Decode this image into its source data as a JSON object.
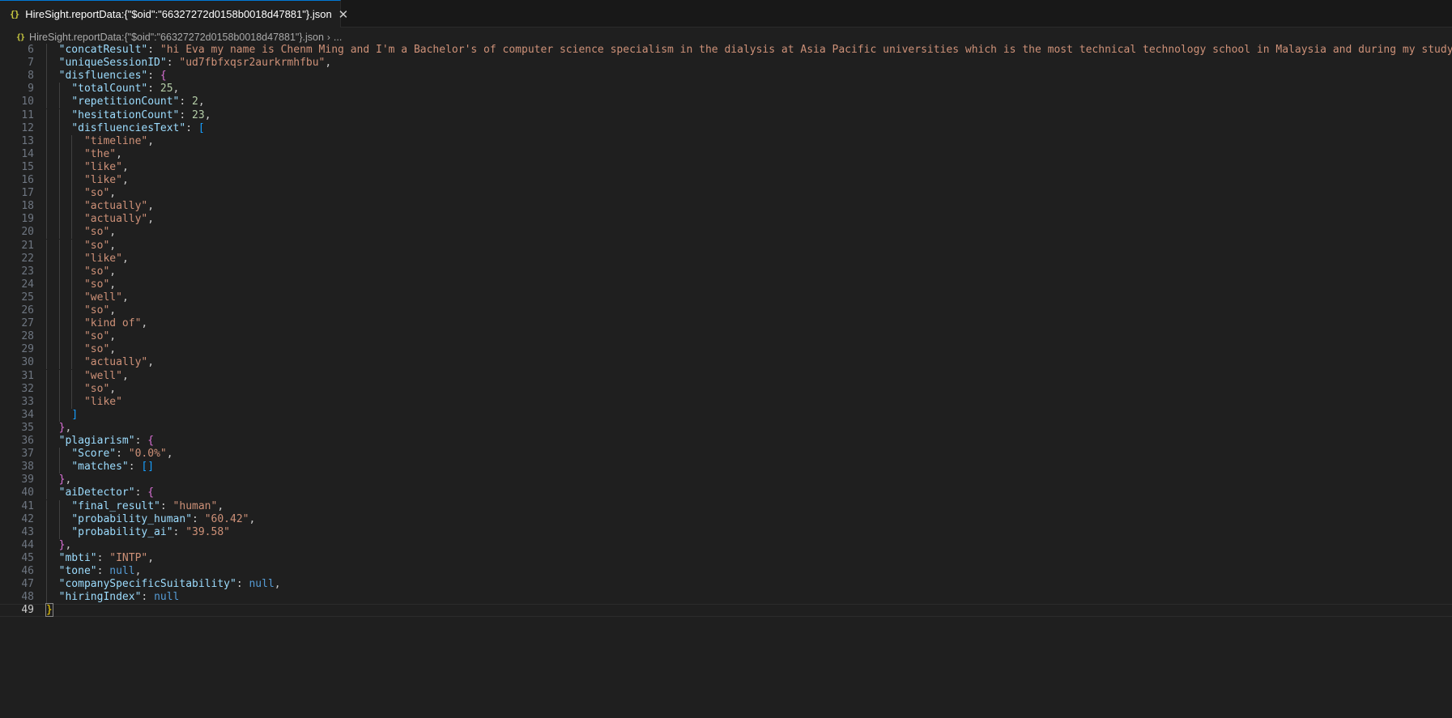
{
  "tab": {
    "title": "HireSight.reportData:{\"$oid\":\"66327272d0158b0018d47881\"}.json",
    "icon": "json-file-icon"
  },
  "breadcrumb": {
    "file": "HireSight.reportData:{\"$oid\":\"66327272d0158b0018d47881\"}.json",
    "more": "..."
  },
  "colors": {
    "key": "#9cdcfe",
    "string": "#ce9178",
    "number": "#b5cea8",
    "constant": "#569cd6",
    "bracket_level1": "#da70d6",
    "bracket_level2": "#179fff",
    "bracket_level0": "#ffd700"
  },
  "editor": {
    "lines": [
      {
        "n": "6",
        "indent": 1,
        "parts": [
          [
            "s",
            "\"concatResult\""
          ],
          [
            "p",
            ": "
          ],
          [
            "v",
            "\"hi Eva my name is Chenm Ming and I'm a Bachelor's of computer science specialism in the dialysis at Asia Pacific universities which is the most technical technology school in Malaysia and during my study I learnt"
          ]
        ]
      },
      {
        "n": "7",
        "indent": 1,
        "parts": [
          [
            "s",
            "\"uniqueSessionID\""
          ],
          [
            "p",
            ": "
          ],
          [
            "v",
            "\"ud7fbfxqsr2aurkrmhfbu\""
          ],
          [
            "p",
            ","
          ]
        ]
      },
      {
        "n": "8",
        "indent": 1,
        "parts": [
          [
            "s",
            "\"disfluencies\""
          ],
          [
            "p",
            ": "
          ],
          [
            "b1",
            "{"
          ]
        ]
      },
      {
        "n": "9",
        "indent": 2,
        "parts": [
          [
            "s",
            "\"totalCount\""
          ],
          [
            "p",
            ": "
          ],
          [
            "n",
            "25"
          ],
          [
            "p",
            ","
          ]
        ]
      },
      {
        "n": "10",
        "indent": 2,
        "parts": [
          [
            "s",
            "\"repetitionCount\""
          ],
          [
            "p",
            ": "
          ],
          [
            "n",
            "2"
          ],
          [
            "p",
            ","
          ]
        ]
      },
      {
        "n": "11",
        "indent": 2,
        "parts": [
          [
            "s",
            "\"hesitationCount\""
          ],
          [
            "p",
            ": "
          ],
          [
            "n",
            "23"
          ],
          [
            "p",
            ","
          ]
        ]
      },
      {
        "n": "12",
        "indent": 2,
        "parts": [
          [
            "s",
            "\"disfluenciesText\""
          ],
          [
            "p",
            ": "
          ],
          [
            "b2",
            "["
          ]
        ]
      },
      {
        "n": "13",
        "indent": 3,
        "parts": [
          [
            "v",
            "\"timeline\""
          ],
          [
            "p",
            ","
          ]
        ]
      },
      {
        "n": "14",
        "indent": 3,
        "parts": [
          [
            "v",
            "\"the\""
          ],
          [
            "p",
            ","
          ]
        ]
      },
      {
        "n": "15",
        "indent": 3,
        "parts": [
          [
            "v",
            "\"like\""
          ],
          [
            "p",
            ","
          ]
        ]
      },
      {
        "n": "16",
        "indent": 3,
        "parts": [
          [
            "v",
            "\"like\""
          ],
          [
            "p",
            ","
          ]
        ]
      },
      {
        "n": "17",
        "indent": 3,
        "parts": [
          [
            "v",
            "\"so\""
          ],
          [
            "p",
            ","
          ]
        ]
      },
      {
        "n": "18",
        "indent": 3,
        "parts": [
          [
            "v",
            "\"actually\""
          ],
          [
            "p",
            ","
          ]
        ]
      },
      {
        "n": "19",
        "indent": 3,
        "parts": [
          [
            "v",
            "\"actually\""
          ],
          [
            "p",
            ","
          ]
        ]
      },
      {
        "n": "20",
        "indent": 3,
        "parts": [
          [
            "v",
            "\"so\""
          ],
          [
            "p",
            ","
          ]
        ]
      },
      {
        "n": "21",
        "indent": 3,
        "parts": [
          [
            "v",
            "\"so\""
          ],
          [
            "p",
            ","
          ]
        ]
      },
      {
        "n": "22",
        "indent": 3,
        "parts": [
          [
            "v",
            "\"like\""
          ],
          [
            "p",
            ","
          ]
        ]
      },
      {
        "n": "23",
        "indent": 3,
        "parts": [
          [
            "v",
            "\"so\""
          ],
          [
            "p",
            ","
          ]
        ]
      },
      {
        "n": "24",
        "indent": 3,
        "parts": [
          [
            "v",
            "\"so\""
          ],
          [
            "p",
            ","
          ]
        ]
      },
      {
        "n": "25",
        "indent": 3,
        "parts": [
          [
            "v",
            "\"well\""
          ],
          [
            "p",
            ","
          ]
        ]
      },
      {
        "n": "26",
        "indent": 3,
        "parts": [
          [
            "v",
            "\"so\""
          ],
          [
            "p",
            ","
          ]
        ]
      },
      {
        "n": "27",
        "indent": 3,
        "parts": [
          [
            "v",
            "\"kind of\""
          ],
          [
            "p",
            ","
          ]
        ]
      },
      {
        "n": "28",
        "indent": 3,
        "parts": [
          [
            "v",
            "\"so\""
          ],
          [
            "p",
            ","
          ]
        ]
      },
      {
        "n": "29",
        "indent": 3,
        "parts": [
          [
            "v",
            "\"so\""
          ],
          [
            "p",
            ","
          ]
        ]
      },
      {
        "n": "30",
        "indent": 3,
        "parts": [
          [
            "v",
            "\"actually\""
          ],
          [
            "p",
            ","
          ]
        ]
      },
      {
        "n": "31",
        "indent": 3,
        "parts": [
          [
            "v",
            "\"well\""
          ],
          [
            "p",
            ","
          ]
        ]
      },
      {
        "n": "32",
        "indent": 3,
        "parts": [
          [
            "v",
            "\"so\""
          ],
          [
            "p",
            ","
          ]
        ]
      },
      {
        "n": "33",
        "indent": 3,
        "parts": [
          [
            "v",
            "\"like\""
          ]
        ]
      },
      {
        "n": "34",
        "indent": 2,
        "parts": [
          [
            "b2",
            "]"
          ]
        ]
      },
      {
        "n": "35",
        "indent": 1,
        "parts": [
          [
            "b1",
            "}"
          ],
          [
            "p",
            ","
          ]
        ]
      },
      {
        "n": "36",
        "indent": 1,
        "parts": [
          [
            "s",
            "\"plagiarism\""
          ],
          [
            "p",
            ": "
          ],
          [
            "b1",
            "{"
          ]
        ]
      },
      {
        "n": "37",
        "indent": 2,
        "parts": [
          [
            "s",
            "\"Score\""
          ],
          [
            "p",
            ": "
          ],
          [
            "v",
            "\"0.0%\""
          ],
          [
            "p",
            ","
          ]
        ]
      },
      {
        "n": "38",
        "indent": 2,
        "parts": [
          [
            "s",
            "\"matches\""
          ],
          [
            "p",
            ": "
          ],
          [
            "b2",
            "[]"
          ]
        ]
      },
      {
        "n": "39",
        "indent": 1,
        "parts": [
          [
            "b1",
            "}"
          ],
          [
            "p",
            ","
          ]
        ]
      },
      {
        "n": "40",
        "indent": 1,
        "parts": [
          [
            "s",
            "\"aiDetector\""
          ],
          [
            "p",
            ": "
          ],
          [
            "b1",
            "{"
          ]
        ]
      },
      {
        "n": "41",
        "indent": 2,
        "parts": [
          [
            "s",
            "\"final_result\""
          ],
          [
            "p",
            ": "
          ],
          [
            "v",
            "\"human\""
          ],
          [
            "p",
            ","
          ]
        ]
      },
      {
        "n": "42",
        "indent": 2,
        "parts": [
          [
            "s",
            "\"probability_human\""
          ],
          [
            "p",
            ": "
          ],
          [
            "v",
            "\"60.42\""
          ],
          [
            "p",
            ","
          ]
        ]
      },
      {
        "n": "43",
        "indent": 2,
        "parts": [
          [
            "s",
            "\"probability_ai\""
          ],
          [
            "p",
            ": "
          ],
          [
            "v",
            "\"39.58\""
          ]
        ]
      },
      {
        "n": "44",
        "indent": 1,
        "parts": [
          [
            "b1",
            "}"
          ],
          [
            "p",
            ","
          ]
        ]
      },
      {
        "n": "45",
        "indent": 1,
        "parts": [
          [
            "s",
            "\"mbti\""
          ],
          [
            "p",
            ": "
          ],
          [
            "v",
            "\"INTP\""
          ],
          [
            "p",
            ","
          ]
        ]
      },
      {
        "n": "46",
        "indent": 1,
        "parts": [
          [
            "s",
            "\"tone\""
          ],
          [
            "p",
            ": "
          ],
          [
            "c",
            "null"
          ],
          [
            "p",
            ","
          ]
        ]
      },
      {
        "n": "47",
        "indent": 1,
        "parts": [
          [
            "s",
            "\"companySpecificSuitability\""
          ],
          [
            "p",
            ": "
          ],
          [
            "c",
            "null"
          ],
          [
            "p",
            ","
          ]
        ]
      },
      {
        "n": "48",
        "indent": 1,
        "parts": [
          [
            "s",
            "\"hiringIndex\""
          ],
          [
            "p",
            ": "
          ],
          [
            "c",
            "null"
          ]
        ]
      },
      {
        "n": "49",
        "indent": 0,
        "current": true,
        "parts": [
          [
            "b0m",
            "}"
          ]
        ]
      }
    ]
  }
}
